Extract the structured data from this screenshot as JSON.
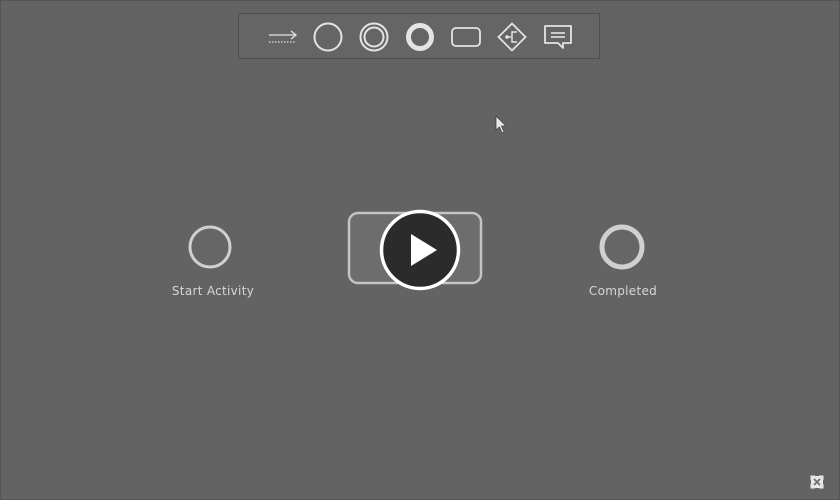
{
  "toolbar": {
    "tools": [
      {
        "name": "sequence-flow",
        "icon": "dotted-arrow-icon"
      },
      {
        "name": "start-event",
        "icon": "circle-icon"
      },
      {
        "name": "intermediate-event",
        "icon": "double-circle-icon"
      },
      {
        "name": "end-event",
        "icon": "thick-circle-icon"
      },
      {
        "name": "task",
        "icon": "rounded-rect-icon"
      },
      {
        "name": "gateway",
        "icon": "diamond-branch-icon"
      },
      {
        "name": "annotation",
        "icon": "comment-icon"
      }
    ]
  },
  "diagram": {
    "start_label": "Start Activity",
    "end_label": "Completed"
  },
  "overlay": {
    "play_icon": "play-icon"
  },
  "controls": {
    "fullscreen_icon": "expand-icon"
  },
  "colors": {
    "background": "#636363",
    "stroke": "#d2d2d2",
    "play_fill": "#2b2b2b"
  }
}
